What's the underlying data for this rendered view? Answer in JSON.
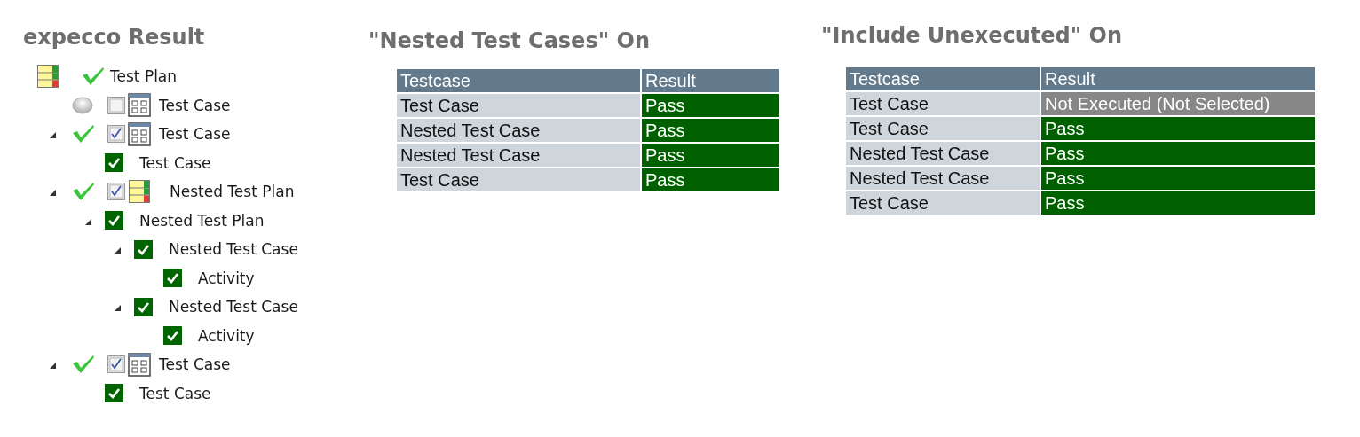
{
  "tree_panel": {
    "title": "expecco Result",
    "root": {
      "kind": "plan",
      "label": "Test Plan",
      "passed": true,
      "children": [
        {
          "kind": "case",
          "label": "Test Case",
          "passed": false,
          "checked": false
        },
        {
          "kind": "case",
          "label": "Test Case",
          "passed": true,
          "checked": true,
          "expanded": true,
          "children": [
            {
              "kind": "result",
              "label": "Test Case"
            }
          ]
        },
        {
          "kind": "plan",
          "label": "Nested Test Plan",
          "passed": true,
          "checked": true,
          "expanded": true,
          "children": [
            {
              "kind": "result",
              "label": "Nested Test Plan",
              "expanded": true,
              "children": [
                {
                  "kind": "result",
                  "label": "Nested Test Case",
                  "expanded": true,
                  "children": [
                    {
                      "kind": "result",
                      "label": "Activity"
                    }
                  ]
                },
                {
                  "kind": "result",
                  "label": "Nested Test Case",
                  "expanded": true,
                  "children": [
                    {
                      "kind": "result",
                      "label": "Activity"
                    }
                  ]
                }
              ]
            }
          ]
        },
        {
          "kind": "case",
          "label": "Test Case",
          "passed": true,
          "checked": true,
          "expanded": true,
          "children": [
            {
              "kind": "result",
              "label": "Test Case"
            }
          ]
        }
      ]
    }
  },
  "tables": [
    {
      "title": "\"Nested Test Cases\" On",
      "columns": [
        "Testcase",
        "Result"
      ],
      "rows": [
        {
          "testcase": "Test Case",
          "result": "Pass",
          "executed": true
        },
        {
          "testcase": "Nested Test Case",
          "result": "Pass",
          "executed": true
        },
        {
          "testcase": "Nested Test Case",
          "result": "Pass",
          "executed": true
        },
        {
          "testcase": "Test Case",
          "result": "Pass",
          "executed": true
        }
      ]
    },
    {
      "title": "\"Include Unexecuted\" On",
      "columns": [
        "Testcase",
        "Result"
      ],
      "rows": [
        {
          "testcase": "Test Case",
          "result": "Not Executed (Not Selected)",
          "executed": false
        },
        {
          "testcase": "Test Case",
          "result": "Pass",
          "executed": true
        },
        {
          "testcase": "Nested Test Case",
          "result": "Pass",
          "executed": true
        },
        {
          "testcase": "Nested Test Case",
          "result": "Pass",
          "executed": true
        },
        {
          "testcase": "Test Case",
          "result": "Pass",
          "executed": true
        }
      ]
    }
  ]
}
